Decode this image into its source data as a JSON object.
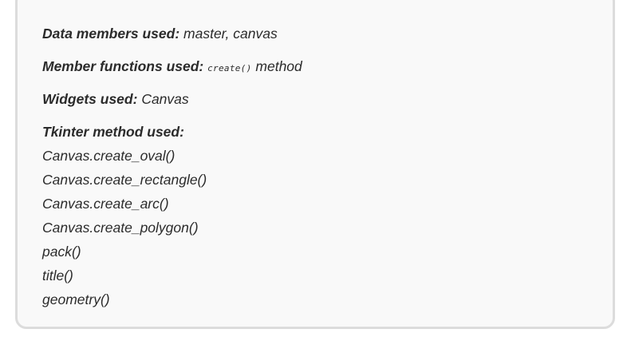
{
  "sections": {
    "data_members": {
      "label": "Data members used:",
      "value": "master, canvas"
    },
    "member_functions": {
      "label": "Member functions used:",
      "code": "create()",
      "suffix": "method"
    },
    "widgets": {
      "label": "Widgets used:",
      "value": "Canvas"
    },
    "tkinter_methods": {
      "label": "Tkinter method used:",
      "items": [
        "Canvas.create_oval()",
        "Canvas.create_rectangle()",
        "Canvas.create_arc()",
        "Canvas.create_polygon()",
        "pack()",
        "title()",
        "geometry()"
      ]
    }
  }
}
